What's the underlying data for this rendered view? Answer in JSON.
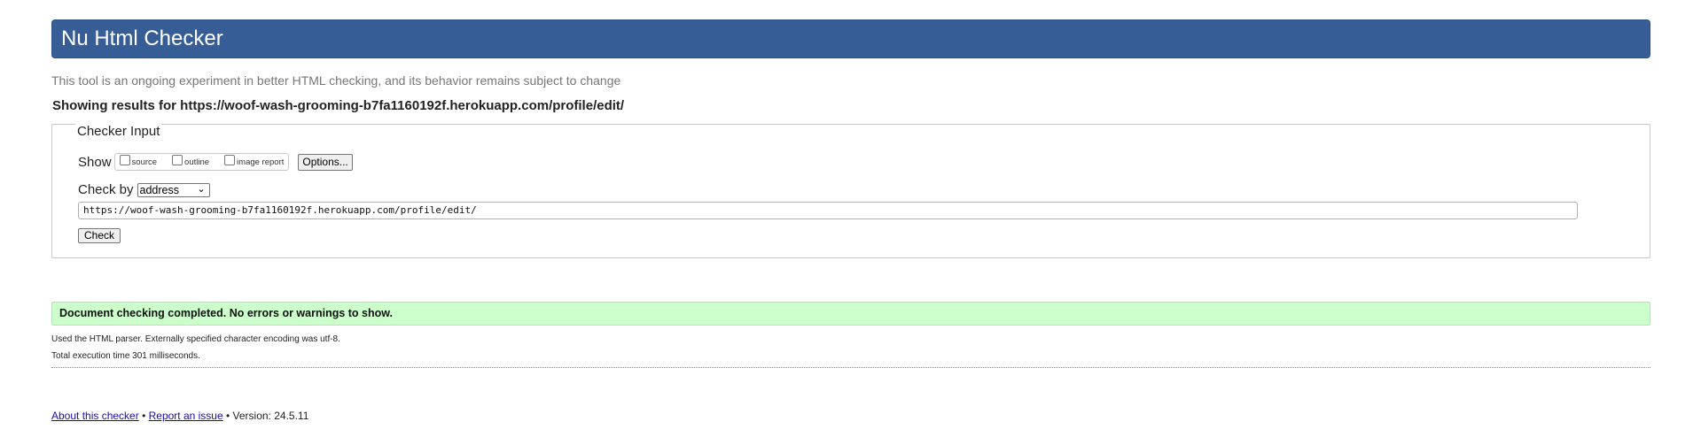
{
  "header": {
    "title": "Nu Html Checker"
  },
  "subtitle": "This tool is an ongoing experiment in better HTML checking, and its behavior remains subject to change",
  "results_for": "Showing results for https://woof-wash-grooming-b7fa1160192f.herokuapp.com/profile/edit/",
  "checker_input": {
    "legend": "Checker Input",
    "show_label": "Show",
    "show_options": [
      {
        "label": "source",
        "checked": false
      },
      {
        "label": "outline",
        "checked": false
      },
      {
        "label": "image report",
        "checked": false
      }
    ],
    "options_button": "Options...",
    "check_by_label": "Check by",
    "check_by_selected": "address",
    "url_value": "https://woof-wash-grooming-b7fa1160192f.herokuapp.com/profile/edit/",
    "check_button": "Check"
  },
  "result": {
    "message": "Document checking completed. No errors or warnings to show.",
    "parser_info": "Used the HTML parser. Externally specified character encoding was utf-8.",
    "execution_time": "Total execution time 301 milliseconds."
  },
  "footer": {
    "about_link": "About this checker",
    "separator1": "•",
    "report_link": "Report an issue",
    "version": "• Version: 24.5.11"
  },
  "colors": {
    "header_bg": "#365d95",
    "success_bg": "#ccffcc",
    "link": "#1a0dab"
  }
}
